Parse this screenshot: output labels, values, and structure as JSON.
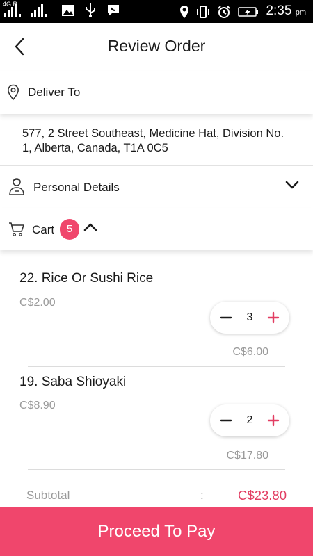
{
  "status_bar": {
    "network": "4G R",
    "time": "2:35",
    "ampm": "pm"
  },
  "header": {
    "title": "Review Order",
    "back_icon": "chevron-left-icon"
  },
  "deliver": {
    "label": "Deliver To",
    "address": "577, 2 Street Southeast, Medicine Hat, Division No. 1, Alberta, Canada, T1A 0C5"
  },
  "personal": {
    "label": "Personal Details"
  },
  "cart": {
    "label": "Cart",
    "count": "5"
  },
  "items": [
    {
      "name": "22. Rice Or Sushi Rice",
      "unit_price": "C$2.00",
      "quantity": "3",
      "total": "C$6.00"
    },
    {
      "name": "19. Saba Shioyaki",
      "unit_price": "C$8.90",
      "quantity": "2",
      "total": "C$17.80"
    }
  ],
  "subtotal": {
    "label": "Subtotal",
    "colon": ":",
    "value": "C$23.80"
  },
  "action": {
    "pay_label": "Proceed To Pay"
  },
  "colors": {
    "accent": "#f0466c",
    "price_accent": "#e23d62",
    "muted_text": "#9a9a9a"
  }
}
